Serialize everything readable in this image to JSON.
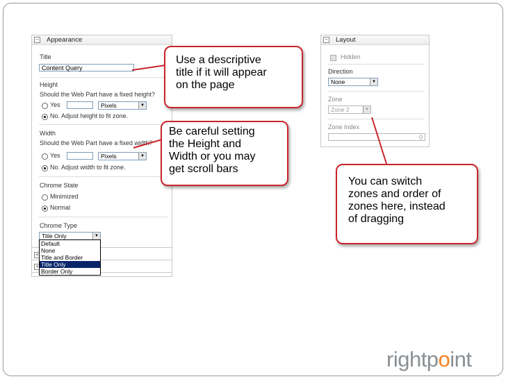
{
  "appearance": {
    "header": "Appearance",
    "toggle": "−",
    "title_label": "Title",
    "title_value": "Content Query",
    "height_label": "Height",
    "height_question": "Should the Web Part have a fixed height?",
    "height_yes": "Yes",
    "height_unit": "Pixels",
    "height_no": "No. Adjust height to fit zone.",
    "width_label": "Width",
    "width_question": "Should the Web Part have a fixed width?",
    "width_yes": "Yes",
    "width_unit": "Pixels",
    "width_no": "No. Adjust width to fit zone.",
    "chrome_state_label": "Chrome State",
    "chrome_minimized": "Minimized",
    "chrome_normal": "Normal",
    "chrome_type_label": "Chrome Type",
    "chrome_type_value": "Title Only",
    "chrome_type_options": [
      "Default",
      "None",
      "Title and Border",
      "Title Only",
      "Border Only"
    ],
    "expand_toggle": "+"
  },
  "layout": {
    "header": "Layout",
    "toggle": "−",
    "hidden_label": "Hidden",
    "direction_label": "Direction",
    "direction_value": "None",
    "zone_label": "Zone",
    "zone_value": "Zone 2",
    "zone_index_label": "Zone Index",
    "zone_index_value": "0"
  },
  "callouts": {
    "title": [
      "Use a descriptive",
      "title if it will appear",
      "on the page"
    ],
    "size": [
      "Be careful setting",
      "the Height and",
      "Width or you may",
      "get scroll bars"
    ],
    "zones": [
      "You can switch",
      "zones and order of",
      "zones here, instead",
      "of dragging"
    ]
  },
  "logo": {
    "part1": "rightp",
    "part2": "o",
    "part3": "int"
  },
  "colors": {
    "callout_border": "#c8242a",
    "logo_gray": "#8a8f93",
    "logo_orange": "#f5821f",
    "selection": "#0a246a"
  }
}
